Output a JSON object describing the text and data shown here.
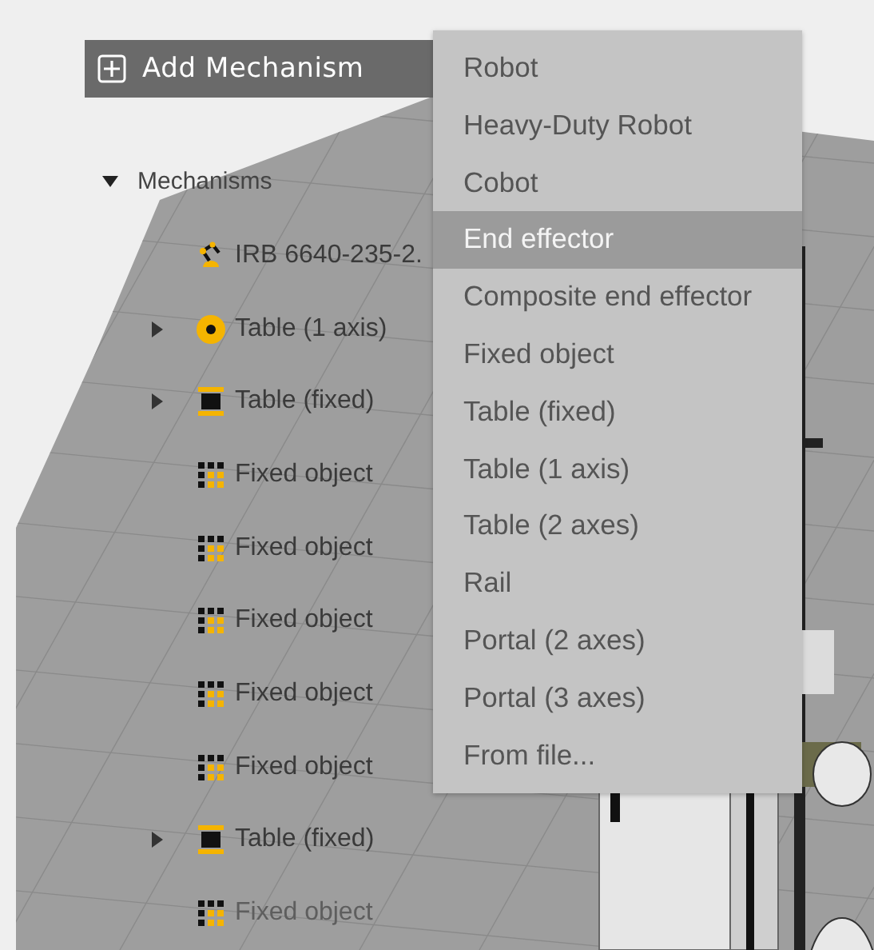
{
  "add_button": {
    "label": "Add Mechanism"
  },
  "tree": {
    "label": "Mechanisms",
    "expanded": true,
    "children": [
      {
        "kind": "robot",
        "label": "IRB 6640-235-2.",
        "expandable": false,
        "dimmed": false
      },
      {
        "kind": "table-axis",
        "label": "Table (1 axis)",
        "expandable": true,
        "dimmed": false
      },
      {
        "kind": "table-fixed",
        "label": "Table (fixed)",
        "expandable": true,
        "dimmed": false
      },
      {
        "kind": "fixed-object",
        "label": "Fixed object",
        "expandable": false,
        "dimmed": false
      },
      {
        "kind": "fixed-object",
        "label": "Fixed object",
        "expandable": false,
        "dimmed": false
      },
      {
        "kind": "fixed-object",
        "label": "Fixed object",
        "expandable": false,
        "dimmed": false
      },
      {
        "kind": "fixed-object",
        "label": "Fixed object",
        "expandable": false,
        "dimmed": false
      },
      {
        "kind": "fixed-object",
        "label": "Fixed object",
        "expandable": false,
        "dimmed": false
      },
      {
        "kind": "table-fixed",
        "label": "Table (fixed)",
        "expandable": true,
        "dimmed": false
      },
      {
        "kind": "fixed-object",
        "label": "Fixed object",
        "expandable": false,
        "dimmed": true
      }
    ]
  },
  "menu": [
    {
      "label": "Robot",
      "selected": false
    },
    {
      "label": "Heavy-Duty Robot",
      "selected": false
    },
    {
      "label": "Cobot",
      "selected": false
    },
    {
      "label": "End effector",
      "selected": true
    },
    {
      "label": "Composite end effector",
      "selected": false
    },
    {
      "label": "Fixed object",
      "selected": false
    },
    {
      "label": "Table (fixed)",
      "selected": false
    },
    {
      "label": "Table (1 axis)",
      "selected": false
    },
    {
      "label": "Table (2 axes)",
      "selected": false
    },
    {
      "label": "Rail",
      "selected": false
    },
    {
      "label": "Portal (2 axes)",
      "selected": false
    },
    {
      "label": "Portal (3 axes)",
      "selected": false
    },
    {
      "label": "From file...",
      "selected": false
    }
  ]
}
